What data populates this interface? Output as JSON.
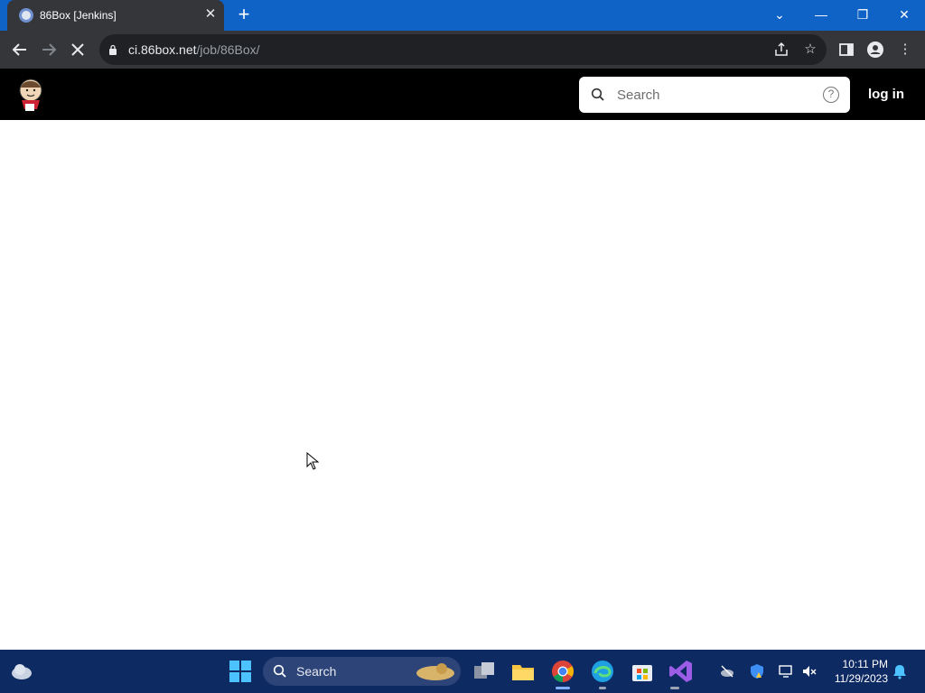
{
  "browser": {
    "tab_title": "86Box [Jenkins]",
    "url_host": "ci.86box.net",
    "url_path": "/job/86Box/"
  },
  "jenkins": {
    "search_placeholder": "Search",
    "login_label": "log in"
  },
  "taskbar": {
    "search_label": "Search",
    "time": "10:11 PM",
    "date": "11/29/2023"
  },
  "icons": {
    "back": "arrow-left",
    "forward": "arrow-right",
    "stop": "close",
    "lock": "lock",
    "share": "share",
    "bookmark": "star",
    "side_panel": "side-panel",
    "profile": "person",
    "menu": "kebab"
  },
  "colors": {
    "titlebar": "#0f62c6",
    "toolbar": "#35363a",
    "omnibox": "#202124",
    "jenkins_header": "#000000",
    "taskbar": "#0e2a63"
  }
}
